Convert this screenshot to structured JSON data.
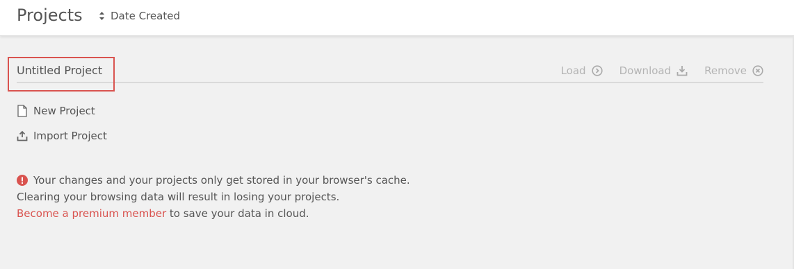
{
  "header": {
    "title": "Projects",
    "sort_label": "Date Created",
    "sort_icon": "sort-updown-icon"
  },
  "project": {
    "name": "Untitled Project",
    "actions": [
      {
        "label": "Load",
        "icon": "circle-chevron-right-icon"
      },
      {
        "label": "Download",
        "icon": "download-tray-icon"
      },
      {
        "label": "Remove",
        "icon": "circle-x-icon"
      }
    ],
    "highlight_color": "#d9534f"
  },
  "menu": {
    "new_project": "New Project",
    "import_project": "Import Project"
  },
  "notice": {
    "line1": "Your changes and your projects only get stored in your browser's cache.",
    "line2": "Clearing your browsing data will result in losing your projects.",
    "link_text": "Become a premium member",
    "line3_rest": " to save your data in cloud.",
    "alert_color": "#d9534f"
  }
}
